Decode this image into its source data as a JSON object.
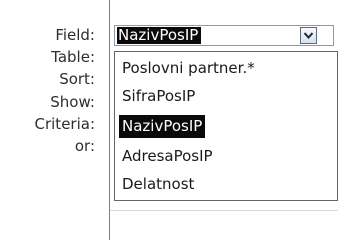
{
  "row_labels": {
    "field": "Field:",
    "table": "Table:",
    "sort": "Sort:",
    "show": "Show:",
    "criteria": "Criteria:",
    "or": "or:"
  },
  "field_combo": {
    "value": "NazivPosIP",
    "button_icon": "chevron-down-icon"
  },
  "dropdown": {
    "options": [
      "Poslovni partner.*",
      "SifraPosIP",
      "NazivPosIP",
      "AdresaPosIP",
      "Delatnost"
    ],
    "selected_index": 2
  },
  "colors": {
    "selection_bg": "#0a0a0a",
    "selection_text": "#ffffff",
    "border": "#646464"
  }
}
